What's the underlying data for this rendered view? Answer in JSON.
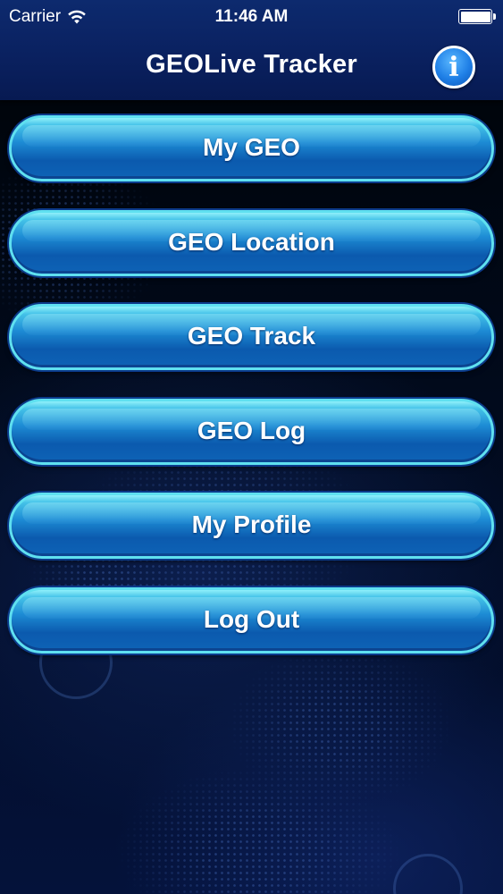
{
  "status_bar": {
    "carrier": "Carrier",
    "time": "11:46 AM",
    "wifi_icon": "wifi-icon",
    "battery_icon": "battery-icon",
    "battery_level": 1.0
  },
  "nav": {
    "title": "GEOLive Tracker",
    "info_icon": "info-icon",
    "info_glyph": "i"
  },
  "menu": {
    "items": [
      {
        "label": "My GEO"
      },
      {
        "label": "GEO Location"
      },
      {
        "label": "GEO Track"
      },
      {
        "label": "GEO Log"
      },
      {
        "label": "My Profile"
      },
      {
        "label": "Log Out"
      }
    ]
  },
  "colors": {
    "nav_bar": "#0a2160",
    "button_rim": "#5fe0f0",
    "button_body": "#1d8bd4",
    "info_button": "#1f7fe6"
  }
}
